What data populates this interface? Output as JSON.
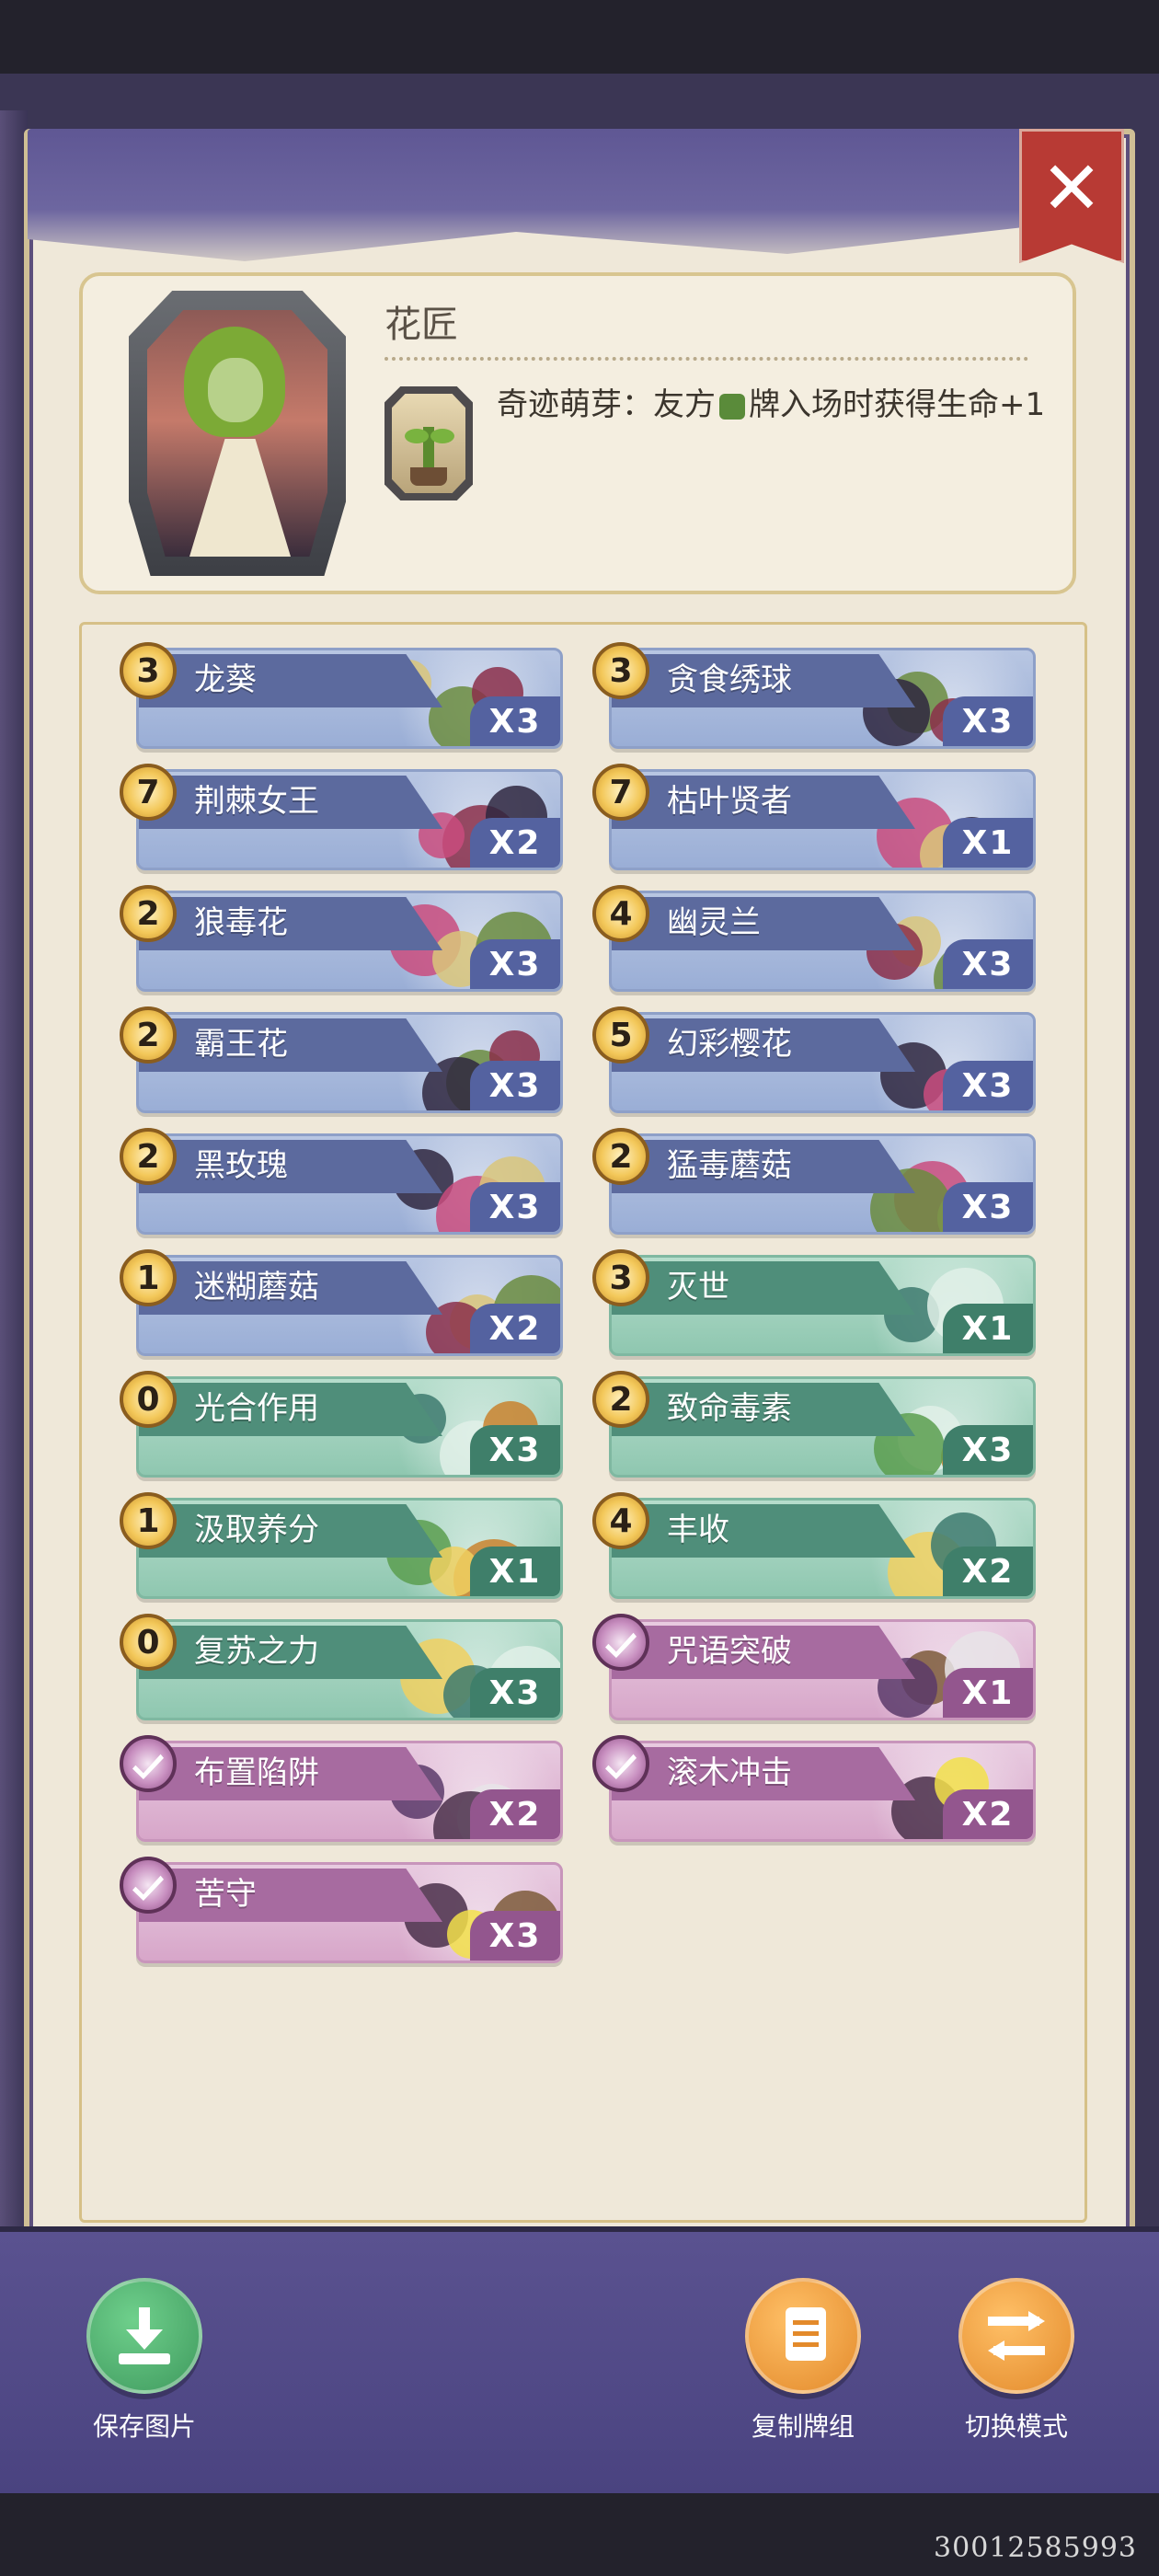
{
  "close_label": "✕",
  "hero": {
    "name": "花匠",
    "skill_text_before": "奇迹萌芽：友方",
    "skill_text_after": "牌入场时获得生命+1"
  },
  "cards": [
    {
      "cost": "3",
      "name": "龙葵",
      "count": "X3",
      "kind": "blue"
    },
    {
      "cost": "3",
      "name": "贪食绣球",
      "count": "X3",
      "kind": "blue"
    },
    {
      "cost": "7",
      "name": "荆棘女王",
      "count": "X2",
      "kind": "blue"
    },
    {
      "cost": "7",
      "name": "枯叶贤者",
      "count": "X1",
      "kind": "blue"
    },
    {
      "cost": "2",
      "name": "狼毒花",
      "count": "X3",
      "kind": "blue"
    },
    {
      "cost": "4",
      "name": "幽灵兰",
      "count": "X3",
      "kind": "blue"
    },
    {
      "cost": "2",
      "name": "霸王花",
      "count": "X3",
      "kind": "blue"
    },
    {
      "cost": "5",
      "name": "幻彩樱花",
      "count": "X3",
      "kind": "blue"
    },
    {
      "cost": "2",
      "name": "黑玫瑰",
      "count": "X3",
      "kind": "blue"
    },
    {
      "cost": "2",
      "name": "猛毒蘑菇",
      "count": "X3",
      "kind": "blue"
    },
    {
      "cost": "1",
      "name": "迷糊蘑菇",
      "count": "X2",
      "kind": "blue"
    },
    {
      "cost": "3",
      "name": "灭世",
      "count": "X1",
      "kind": "green"
    },
    {
      "cost": "0",
      "name": "光合作用",
      "count": "X3",
      "kind": "green"
    },
    {
      "cost": "2",
      "name": "致命毒素",
      "count": "X3",
      "kind": "green"
    },
    {
      "cost": "1",
      "name": "汲取养分",
      "count": "X1",
      "kind": "green"
    },
    {
      "cost": "4",
      "name": "丰收",
      "count": "X2",
      "kind": "green"
    },
    {
      "cost": "0",
      "name": "复苏之力",
      "count": "X3",
      "kind": "green"
    },
    {
      "cost": "",
      "name": "咒语突破",
      "count": "X1",
      "kind": "pink"
    },
    {
      "cost": "",
      "name": "布置陷阱",
      "count": "X2",
      "kind": "pink"
    },
    {
      "cost": "",
      "name": "滚木冲击",
      "count": "X2",
      "kind": "pink"
    },
    {
      "cost": "",
      "name": "苦守",
      "count": "X3",
      "kind": "pink"
    }
  ],
  "actions": {
    "save_label": "保存图片",
    "copy_label": "复制牌组",
    "switch_label": "切换模式"
  },
  "watermark": "30012585993",
  "colors": {
    "unit_card": "#9aaed6",
    "spell_card": "#8fc7b0",
    "trap_card": "#d7a6c9",
    "cost_coin": "#f3c85a",
    "close_button": "#b83a34"
  }
}
